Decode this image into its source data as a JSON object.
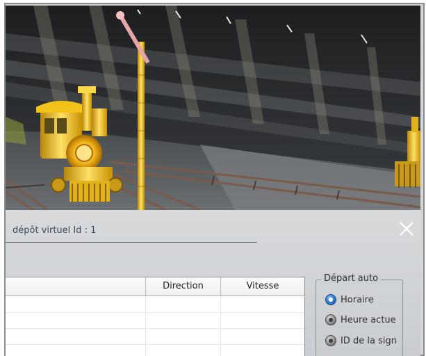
{
  "dialog": {
    "title": "dépôt virtuel Id : 1",
    "close_icon": "close-icon"
  },
  "table": {
    "columns": [
      "",
      "Direction",
      "Vitesse"
    ],
    "rows": [
      [
        "",
        "",
        ""
      ],
      [
        "",
        "",
        ""
      ],
      [
        "",
        "",
        ""
      ],
      [
        "",
        "",
        ""
      ]
    ]
  },
  "depart_auto": {
    "title": "Départ auto",
    "options": [
      {
        "label": "Horaire",
        "selected": true
      },
      {
        "label": "Heure actue",
        "selected": false
      },
      {
        "label": "ID de la sign",
        "selected": false
      }
    ]
  },
  "scene": {
    "description_icons": [
      "locomotive-icon",
      "signal-post-icon",
      "rail-track-icon"
    ],
    "colors": {
      "gold": "#f2c21a",
      "dark": "#2a2c2e"
    }
  }
}
